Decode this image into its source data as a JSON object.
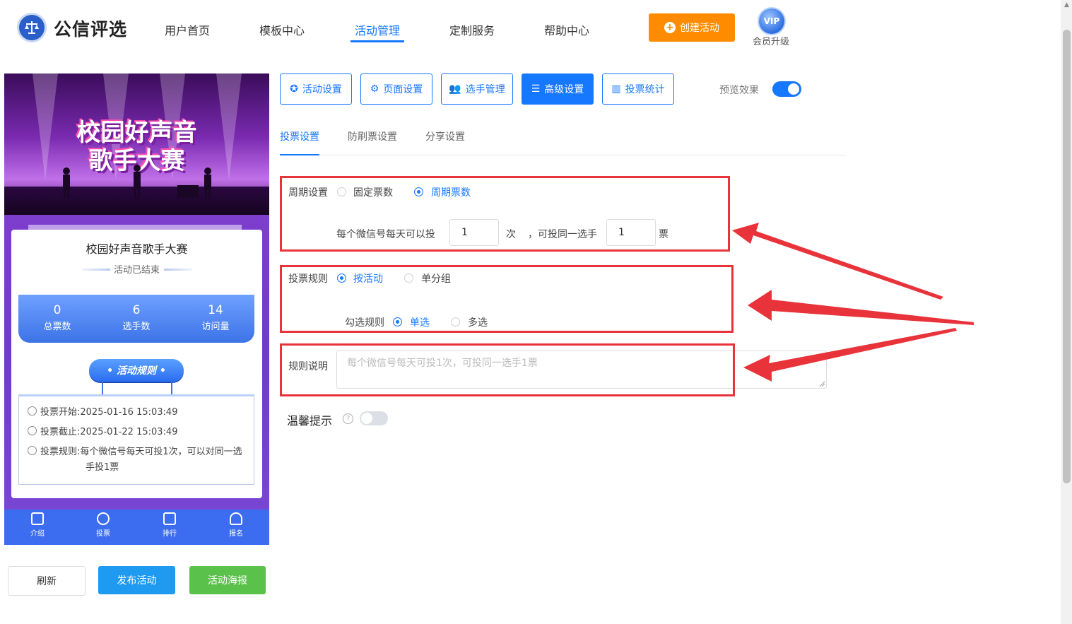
{
  "brand": {
    "name": "公信评选"
  },
  "nav": {
    "items": [
      {
        "label": "用户首页"
      },
      {
        "label": "模板中心"
      },
      {
        "label": "活动管理"
      },
      {
        "label": "定制服务"
      },
      {
        "label": "帮助中心"
      }
    ],
    "active_index": 2,
    "create_label": "创建活动",
    "vip_badge": "VIP",
    "vip_label": "会员升级"
  },
  "preview": {
    "banner_line1": "校园好声音",
    "banner_line2": "歌手大赛",
    "title": "校园好声音歌手大赛",
    "status": "活动已结束",
    "stats": [
      {
        "value": "0",
        "label": "总票数"
      },
      {
        "value": "6",
        "label": "选手数"
      },
      {
        "value": "14",
        "label": "访问量"
      }
    ],
    "rules_button": "• 活动规则 •",
    "rules": {
      "start_label": "投票开始:",
      "start_value": "2025-01-16 15:03:49",
      "end_label": "投票截止:",
      "end_value": "2025-01-22 15:03:49",
      "rule_label": "投票规则:",
      "rule_value_line1": "每个微信号每天可投1次，可以对同一选",
      "rule_value_line2": "手投1票"
    },
    "tabbar": [
      {
        "label": "介绍"
      },
      {
        "label": "投票"
      },
      {
        "label": "排行"
      },
      {
        "label": "报名"
      }
    ]
  },
  "actions": {
    "refresh": "刷新",
    "publish": "发布活动",
    "poster": "活动海报"
  },
  "toolbar": {
    "buttons": [
      {
        "label": "活动设置",
        "icon": "star-icon"
      },
      {
        "label": "页面设置",
        "icon": "gear-icon"
      },
      {
        "label": "选手管理",
        "icon": "users-icon"
      },
      {
        "label": "高级设置",
        "icon": "sliders-icon"
      },
      {
        "label": "投票统计",
        "icon": "bar-chart-icon"
      }
    ],
    "active_index": 3,
    "preview_label": "预览效果",
    "preview_on": true
  },
  "subtabs": {
    "items": [
      {
        "label": "投票设置"
      },
      {
        "label": "防刷票设置"
      },
      {
        "label": "分享设置"
      }
    ],
    "active_index": 0
  },
  "form": {
    "period": {
      "label": "周期设置",
      "options": [
        {
          "label": "固定票数",
          "checked": false
        },
        {
          "label": "周期票数",
          "checked": true
        }
      ],
      "prefix": "每个微信号每天可以投",
      "times_value": "1",
      "times_unit": "次",
      "middle": "，可投同一选手",
      "votes_value": "1",
      "votes_unit": "票"
    },
    "rule": {
      "label": "投票规则",
      "options": [
        {
          "label": "按活动",
          "checked": true
        },
        {
          "label": "单分组",
          "checked": false
        }
      ],
      "check_label": "勾选规则",
      "check_options": [
        {
          "label": "单选",
          "checked": true
        },
        {
          "label": "多选",
          "checked": false
        }
      ]
    },
    "description": {
      "label": "规则说明",
      "placeholder": "每个微信号每天可投1次，可投同一选手1票"
    },
    "tip": {
      "label": "温馨提示",
      "help": "?",
      "enabled": false
    }
  },
  "colors": {
    "accent": "#1677ff",
    "create": "#ff8c00",
    "highlight": "#e8333a",
    "publish": "#1e9af0",
    "poster": "#5ac14a"
  }
}
